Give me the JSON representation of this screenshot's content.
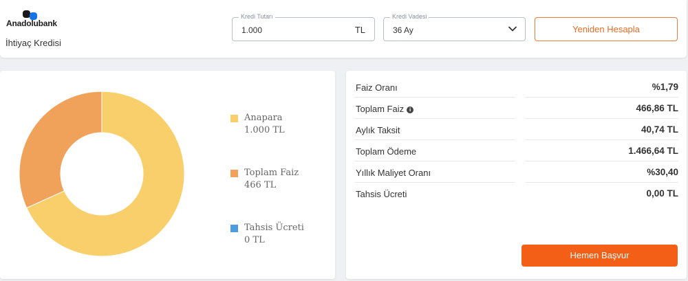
{
  "brand": {
    "name": "Anadolubank",
    "product": "İhtiyaç Kredisi"
  },
  "form": {
    "amount_label": "Kredi Tutarı",
    "amount_value": "1.000",
    "amount_unit": "TL",
    "term_label": "Kredi Vadesi",
    "term_value": "36 Ay",
    "recalculate_label": "Yeniden Hesapla"
  },
  "chart_data": {
    "type": "pie",
    "categories": [
      "Anapara",
      "Toplam Faiz",
      "Tahsis Ücreti"
    ],
    "values": [
      1000,
      466,
      0
    ],
    "value_labels": [
      "1.000 TL",
      "466 TL",
      "0 TL"
    ],
    "colors": [
      "#f8cf6a",
      "#f0a25a",
      "#4f9be0"
    ],
    "donut": true,
    "legend_position": "right"
  },
  "summary": {
    "rows": [
      {
        "label": "Faiz Oranı",
        "value": "%1,79"
      },
      {
        "label": "Toplam Faiz",
        "value": "466,86 TL",
        "icon": "info-icon"
      },
      {
        "label": "Aylık Taksit",
        "value": "40,74 TL"
      },
      {
        "label": "Toplam Ödeme",
        "value": "1.466,64 TL"
      },
      {
        "label": "Yıllık Maliyet Oranı",
        "value": "%30,40"
      },
      {
        "label": "Tahsis Ücreti",
        "value": "0,00 TL"
      }
    ],
    "apply_label": "Hemen Başvur"
  },
  "colors": {
    "accent": "#f35f16",
    "outline_button": "#ea6b25",
    "brand_blue": "#1473e6"
  }
}
